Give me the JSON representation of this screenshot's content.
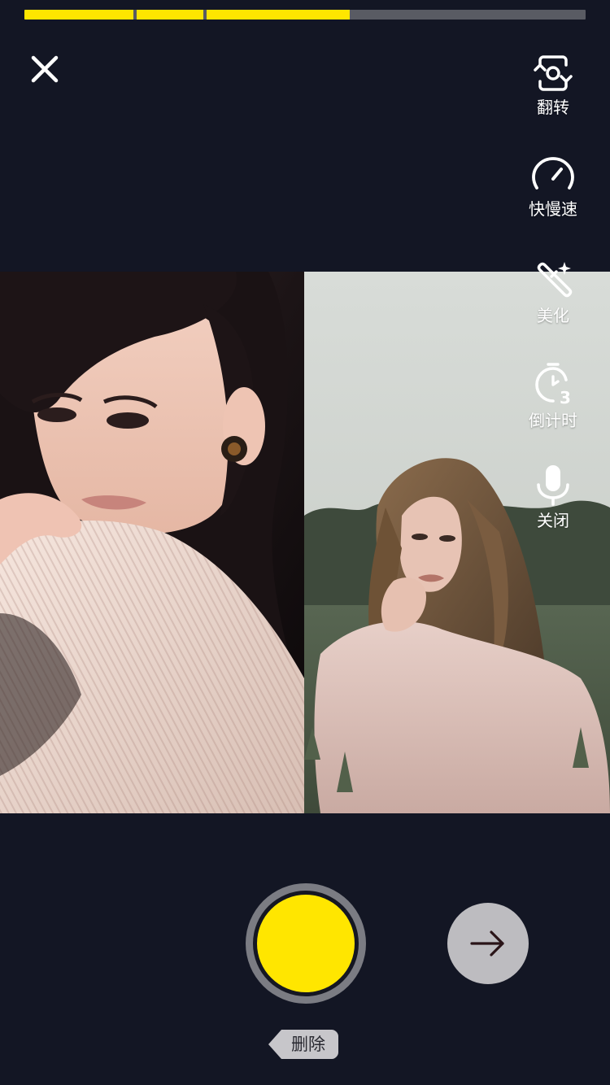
{
  "recording": {
    "segments_progress": [
      0.194,
      0.119,
      0.255
    ],
    "total_progress": 0.58
  },
  "toolbar": {
    "close_icon": "close-icon",
    "tools": [
      {
        "icon": "flip-camera-icon",
        "label": "翻转"
      },
      {
        "icon": "speedometer-icon",
        "label": "快慢速"
      },
      {
        "icon": "magic-wand-icon",
        "label": "美化"
      },
      {
        "icon": "timer-icon",
        "label": "倒计时"
      },
      {
        "icon": "microphone-icon",
        "label": "关闭"
      }
    ]
  },
  "controls": {
    "record_icon": "record-button",
    "next_icon": "arrow-right-icon",
    "delete_label": "删除"
  },
  "colors": {
    "accent": "#ffe600",
    "background": "#131624",
    "next_button": "#bdbcc0"
  }
}
